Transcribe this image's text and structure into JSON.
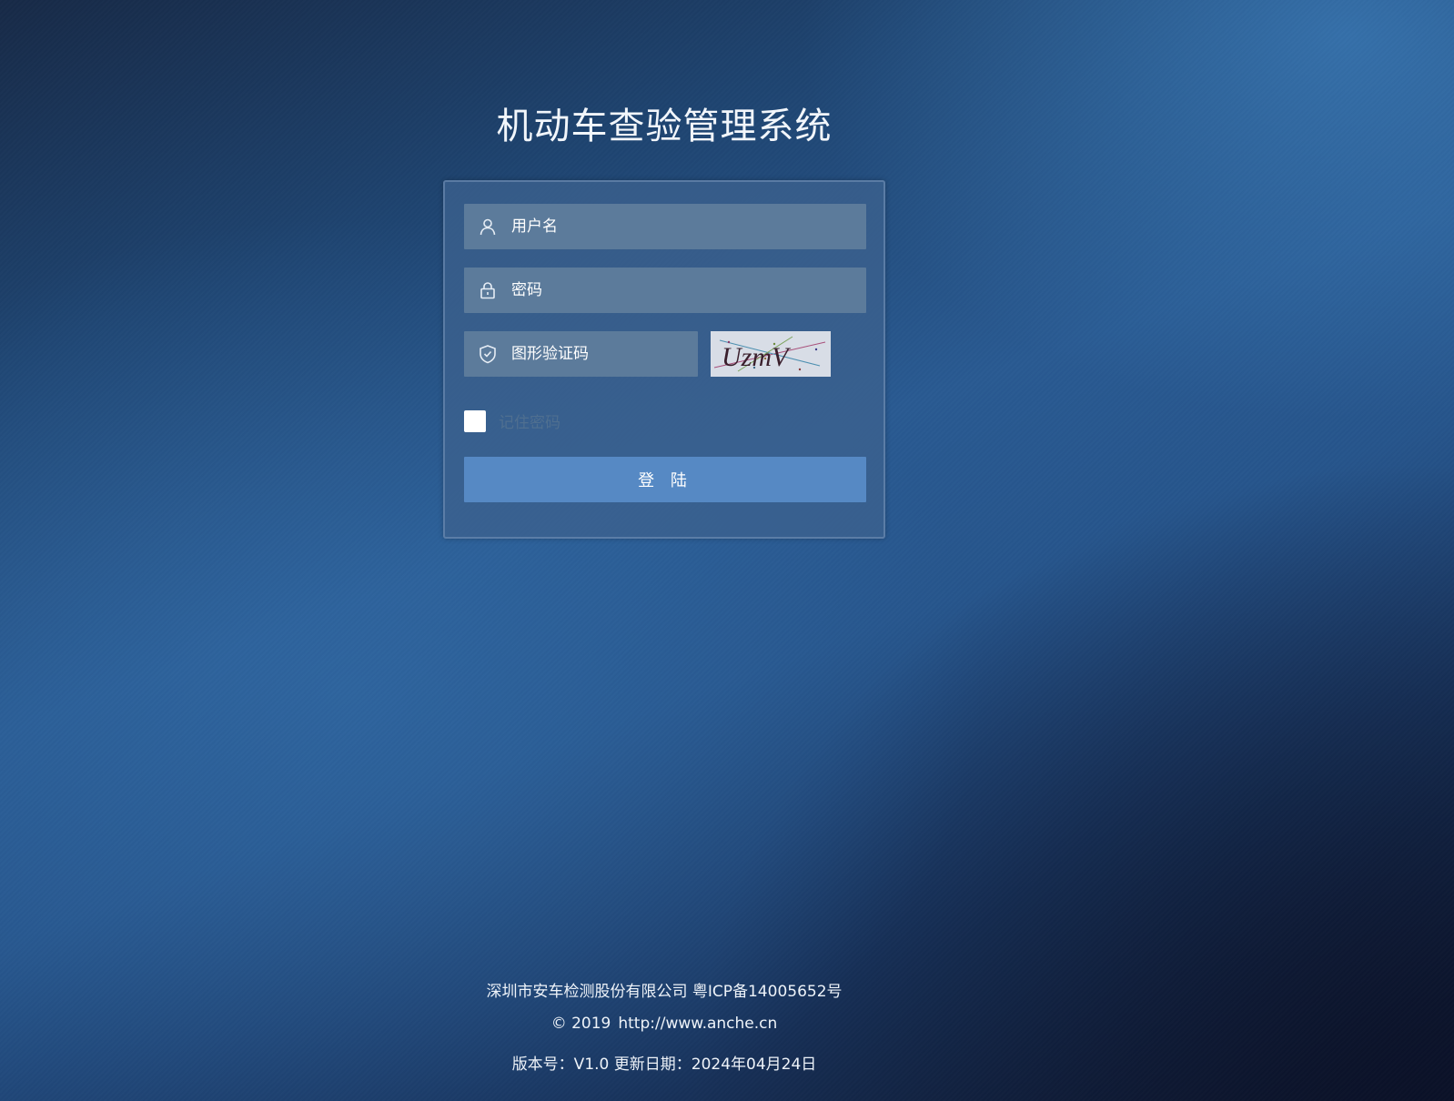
{
  "page": {
    "title": "机动车查验管理系统"
  },
  "login": {
    "username_placeholder": "用户名",
    "username_icon": "user-icon",
    "password_placeholder": "密码",
    "password_icon": "lock-icon",
    "captcha_placeholder": "图形验证码",
    "captcha_icon": "shield-check-icon",
    "captcha_text": "UzmV",
    "remember_label": "记住密码",
    "remember_checked": false,
    "submit_label": "登 陆"
  },
  "footer": {
    "company": "深圳市安车检测股份有限公司 粤ICP备14005652号",
    "copyright": "© 2019",
    "url": "http://www.anche.cn",
    "version": "版本号：V1.0 更新日期：2024年04月24日"
  },
  "colors": {
    "field_background": "#5c7b9b",
    "button_background": "#5689c4",
    "card_background": "#3c628e"
  }
}
